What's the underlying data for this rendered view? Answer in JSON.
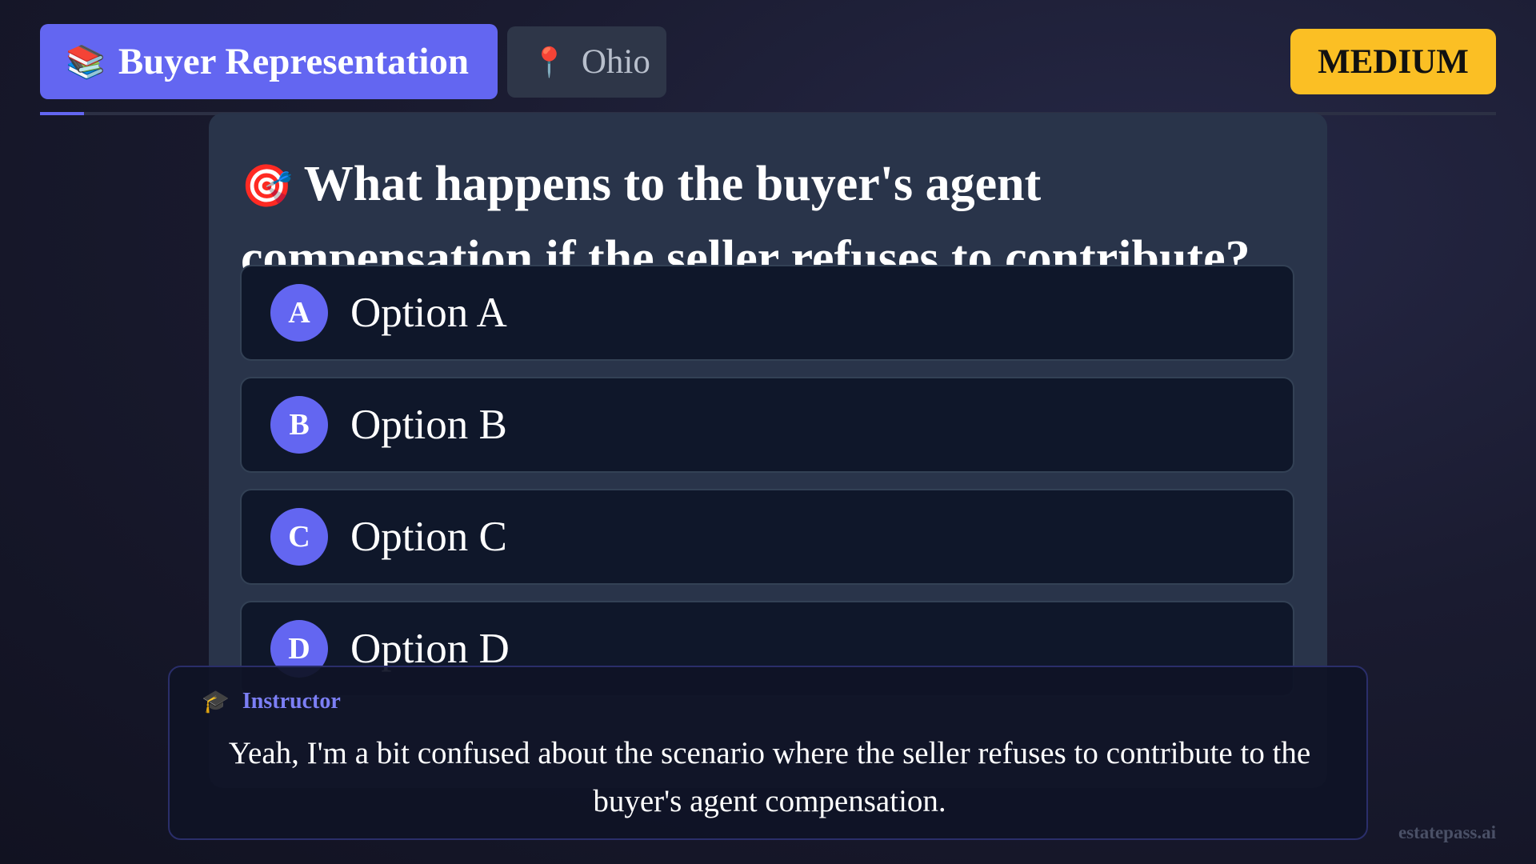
{
  "header": {
    "topic_icon": "📚",
    "topic_icon_name": "books-icon",
    "topic": "Buyer Representation",
    "state_icon": "📍",
    "state_icon_name": "pin-icon",
    "state": "Ohio",
    "difficulty": "MEDIUM"
  },
  "progress": {
    "fraction": 0.03
  },
  "question": {
    "icon": "🎯",
    "icon_name": "target-icon",
    "text": "What happens to the buyer's agent compensation if the seller refuses to contribute?"
  },
  "options": [
    {
      "letter": "A",
      "label": "Option A"
    },
    {
      "letter": "B",
      "label": "Option B"
    },
    {
      "letter": "C",
      "label": "Option C"
    },
    {
      "letter": "D",
      "label": "Option D"
    }
  ],
  "caption": {
    "speaker_icon": "🎓",
    "speaker_icon_name": "graduation-cap-icon",
    "speaker": "Instructor",
    "text": "Yeah, I'm a bit confused about the scenario where the seller refuses to contribute to the buyer's agent compensation."
  },
  "watermark": "estatepass.ai",
  "colors": {
    "accent": "#6366f1",
    "difficulty_badge": "#fbbf24",
    "card_background": "#29344a",
    "option_background": "#0f172a"
  }
}
